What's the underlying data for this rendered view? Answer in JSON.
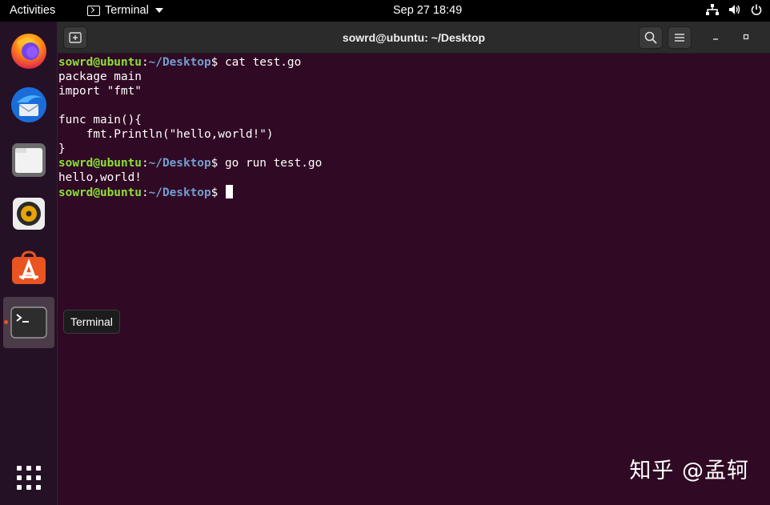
{
  "topbar": {
    "activities": "Activities",
    "app_menu": "Terminal",
    "clock": "Sep 27  18:49",
    "tray_icons": [
      "network-icon",
      "volume-icon",
      "power-icon"
    ]
  },
  "dock": {
    "items": [
      {
        "name": "Firefox",
        "icon": "firefox-icon"
      },
      {
        "name": "Thunderbird",
        "icon": "thunderbird-icon"
      },
      {
        "name": "Files",
        "icon": "files-icon"
      },
      {
        "name": "Rhythmbox",
        "icon": "rhythmbox-icon"
      },
      {
        "name": "Ubuntu Software",
        "icon": "software-icon"
      },
      {
        "name": "Terminal",
        "icon": "terminal-icon",
        "active": true
      }
    ],
    "apps_grid_icon": "show-apps-icon",
    "tooltip": "Terminal"
  },
  "window": {
    "title": "sowrd@ubuntu: ~/Desktop",
    "buttons": [
      "new-tab-icon",
      "search-icon",
      "hamburger-menu-icon",
      "minimize-icon",
      "maximize-icon"
    ]
  },
  "terminal": {
    "prompt_user": "sowrd@ubuntu",
    "prompt_sep": ":",
    "prompt_path": "~/Desktop",
    "prompt_end": "$ ",
    "cmd1": "cat test.go",
    "out1": "package main",
    "out2": "import \"fmt\"",
    "out3": "",
    "out4": "func main(){",
    "out5": "    fmt.Println(\"hello,world!\")",
    "out6": "}",
    "cmd2": "go run test.go",
    "out7": "hello,world!",
    "cmd3": ""
  },
  "watermark": "知乎 @孟轲",
  "colors": {
    "terminal_bg": "#300a24",
    "prompt_user": "#8ae234",
    "prompt_path": "#729fcf",
    "accent": "#e95420"
  }
}
